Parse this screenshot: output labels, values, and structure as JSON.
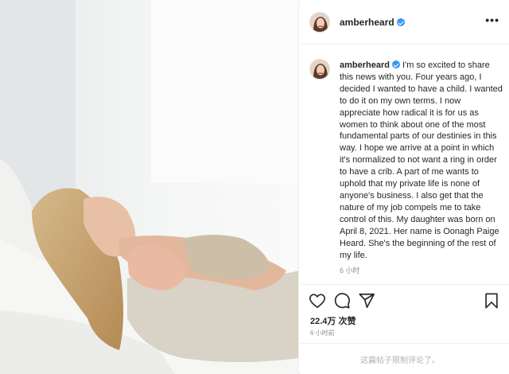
{
  "post": {
    "username": "amberheard",
    "more_label": "•••",
    "caption_text": "I'm so excited to share this news with you. Four years ago, I decided I wanted to have a child. I wanted to do it on my own terms. I now appreciate how radical it is for us as women to think about one of the most fundamental parts of our destinies in this way. I hope we arrive at a point in which it's normalized to not want a ring in order to have a crib. A part of me wants to uphold that my private life is none of anyone's business. I also get that the nature of my job compels me to take control of this. My daughter was born on April 8, 2021. Her name is Oonagh Paige Heard. She's the beginning of the rest of my life.",
    "caption_time": "6 小时",
    "likes": "22.4万 次赞",
    "post_time": "6 小时前",
    "comments_disabled": "这篇帖子限制评论了。"
  },
  "icons": {
    "like": "heart-icon",
    "comment": "comment-icon",
    "share": "share-icon",
    "save": "bookmark-icon",
    "verified": "verified-badge-icon",
    "more": "more-icon"
  },
  "colors": {
    "verified": "#3897f0",
    "secondary_text": "#8e8e8e",
    "border": "#dbdbdb"
  }
}
